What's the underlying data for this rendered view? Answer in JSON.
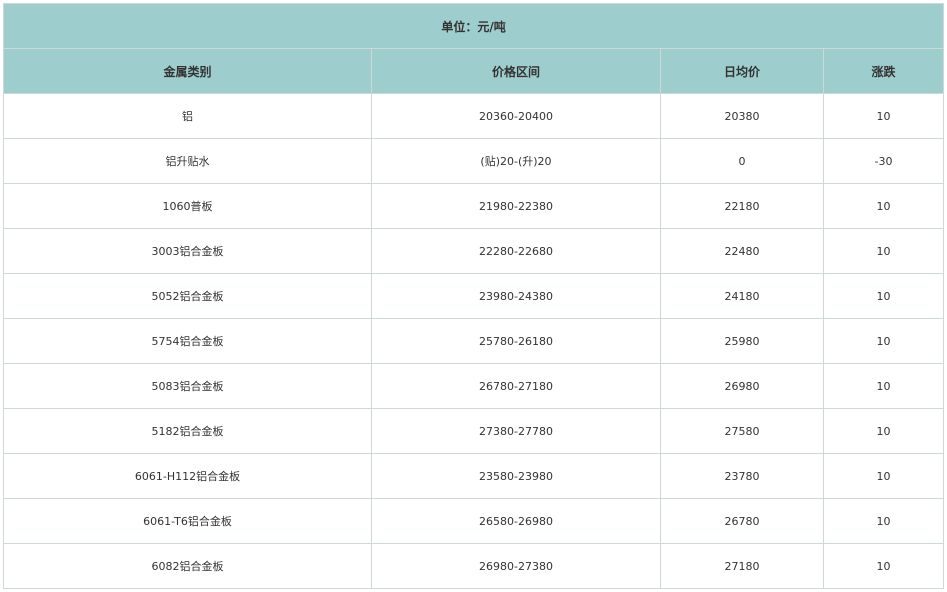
{
  "unit_label": "单位：元/吨",
  "headers": {
    "category": "金属类别",
    "range": "价格区间",
    "avg": "日均价",
    "change": "涨跌"
  },
  "rows": [
    {
      "category": "铝",
      "range": "20360-20400",
      "avg": "20380",
      "change": "10"
    },
    {
      "category": "铝升贴水",
      "range": "(贴)20-(升)20",
      "avg": "0",
      "change": "-30"
    },
    {
      "category": "1060普板",
      "range": "21980-22380",
      "avg": "22180",
      "change": "10"
    },
    {
      "category": "3003铝合金板",
      "range": "22280-22680",
      "avg": "22480",
      "change": "10"
    },
    {
      "category": "5052铝合金板",
      "range": "23980-24380",
      "avg": "24180",
      "change": "10"
    },
    {
      "category": "5754铝合金板",
      "range": "25780-26180",
      "avg": "25980",
      "change": "10"
    },
    {
      "category": "5083铝合金板",
      "range": "26780-27180",
      "avg": "26980",
      "change": "10"
    },
    {
      "category": "5182铝合金板",
      "range": "27380-27780",
      "avg": "27580",
      "change": "10"
    },
    {
      "category": "6061-H112铝合金板",
      "range": "23580-23980",
      "avg": "23780",
      "change": "10"
    },
    {
      "category": "6061-T6铝合金板",
      "range": "26580-26980",
      "avg": "26780",
      "change": "10"
    },
    {
      "category": "6082铝合金板",
      "range": "26980-27380",
      "avg": "27180",
      "change": "10"
    }
  ]
}
